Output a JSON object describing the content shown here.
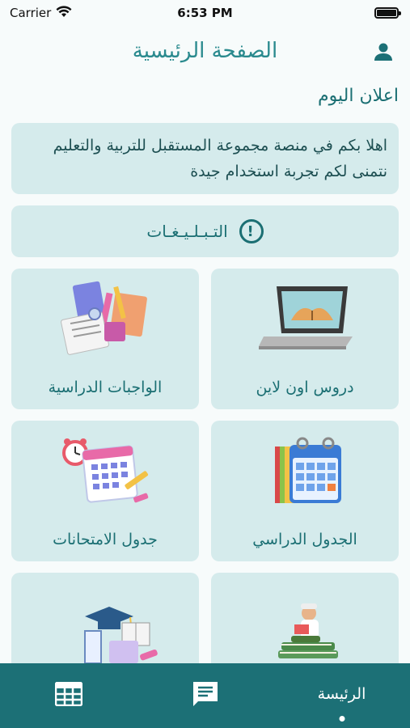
{
  "status_bar": {
    "carrier": "Carrier",
    "time": "6:53 PM",
    "battery_level": 1.0
  },
  "header": {
    "title": "الصفحة الرئيسية",
    "profile_icon": "person-icon"
  },
  "announcement": {
    "heading": "اعلان اليوم",
    "text": "اهلا بكم في منصة مجموعة المستقبل للتربية والتعليم نتمنى لكم تجربة استخدام جيدة"
  },
  "notices": {
    "label": "التـبـلـيـغـات",
    "icon": "exclamation-circle-icon"
  },
  "cards": [
    {
      "label": "دروس اون لاين",
      "icon": "laptop-book-icon"
    },
    {
      "label": "الواجبات الدراسية",
      "icon": "homework-icon"
    },
    {
      "label": "الجدول الدراسي",
      "icon": "calendar-icon"
    },
    {
      "label": "جدول الامتحانات",
      "icon": "exam-schedule-icon"
    },
    {
      "label": "",
      "icon": "reading-student-icon"
    },
    {
      "label": "",
      "icon": "graduation-books-icon"
    }
  ],
  "bottom_nav": {
    "home_label": "الرئيسة",
    "messages_icon": "message-icon",
    "schedule_icon": "table-icon"
  },
  "colors": {
    "primary": "#1c7076",
    "card_bg": "#d5ebec",
    "text_teal": "#1b6f73"
  }
}
